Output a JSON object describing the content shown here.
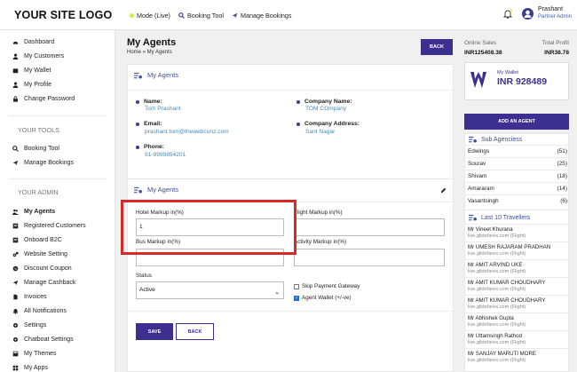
{
  "header": {
    "logo": "YOUR SITE LOGO",
    "nav": [
      {
        "label": "Mode (Live)",
        "icon": "status-dot-icon"
      },
      {
        "label": "Booking Tool",
        "icon": "search-icon"
      },
      {
        "label": "Manage Bookings",
        "icon": "plane-icon"
      }
    ],
    "user": {
      "name": "Prashant",
      "role": "Partner Admin"
    }
  },
  "sidebar": {
    "group1": [
      {
        "label": "Dashboard",
        "icon": "dashboard-icon"
      },
      {
        "label": "My Customers",
        "icon": "user-icon"
      },
      {
        "label": "My Wallet",
        "icon": "wallet-icon"
      },
      {
        "label": "My Profile",
        "icon": "user-icon"
      },
      {
        "label": "Change Password",
        "icon": "lock-icon"
      }
    ],
    "tools_heading": "YOUR TOOLS",
    "tools": [
      {
        "label": "Booking Tool",
        "icon": "search-icon"
      },
      {
        "label": "Manage Bookings",
        "icon": "plane-icon"
      }
    ],
    "admin_heading": "YOUR ADMIN",
    "admin": [
      {
        "label": "My Agents",
        "icon": "users-icon",
        "active": true
      },
      {
        "label": "Registered Customers",
        "icon": "list-icon"
      },
      {
        "label": "Onboard B2C",
        "icon": "list-icon"
      },
      {
        "label": "Website Setting",
        "icon": "gears-icon"
      },
      {
        "label": "Discount Coupon",
        "icon": "coupon-icon"
      },
      {
        "label": "Manage Cashback",
        "icon": "plane-icon"
      },
      {
        "label": "Invoices",
        "icon": "file-icon"
      },
      {
        "label": "All Notifications",
        "icon": "bell-icon"
      },
      {
        "label": "Settings",
        "icon": "gear-icon"
      },
      {
        "label": "Chatboat Settings",
        "icon": "gear-icon"
      },
      {
        "label": "My Themes",
        "icon": "theme-icon"
      },
      {
        "label": "My Apps",
        "icon": "apps-icon"
      }
    ]
  },
  "page": {
    "title": "My Agents",
    "breadcrumb": "Home » My Agents",
    "back_label": "BACK"
  },
  "agent_card": {
    "heading": "My Agents",
    "name_label": "Name:",
    "name": "Tom Prashant",
    "company_label": "Company Name:",
    "company": "TOM COmpany",
    "email_label": "Email:",
    "email": "prashant.tom@thewebconz.com",
    "address_label": "Company Address:",
    "address": "Sant Nagar",
    "phone_label": "Phone:",
    "phone": "91-9999854201"
  },
  "form": {
    "heading": "My Agents",
    "hotel_markup_label": "Hotel Markup in(%)",
    "hotel_markup_value": "1",
    "flight_markup_label": "Flight Markup in(%)",
    "flight_markup_value": "",
    "bus_markup_label": "Bus Markup in(%)",
    "bus_markup_value": "",
    "activity_markup_label": "Activity Markup in(%)",
    "activity_markup_value": "",
    "status_label": "Status",
    "status_value": "Active",
    "skip_payment_label": "Skip Payment Gateway",
    "skip_payment_checked": false,
    "agent_wallet_label": "Agent Wallet (+/-ve)",
    "agent_wallet_checked": true,
    "save_label": "SAVE",
    "back_label": "BACK"
  },
  "right_panel": {
    "online_sales_label": "Online Sales",
    "online_sales": "INR125408.38",
    "total_profit_label": "Total Profit",
    "total_profit": "INR38.78",
    "wallet_label": "My Wallet",
    "wallet_amount": "INR 928489",
    "add_agent_label": "ADD AN AGENT",
    "sub_agencies_heading": "Sub Agenciess",
    "sub_agencies": [
      {
        "name": "Edwings",
        "count": "(51)"
      },
      {
        "name": "Sourav",
        "count": "(25)"
      },
      {
        "name": "Shivam",
        "count": "(18)"
      },
      {
        "name": "Amararam",
        "count": "(14)"
      },
      {
        "name": "Vasantsingh",
        "count": "(6)"
      }
    ],
    "travellers_heading": "Last 10 Travellers",
    "travellers": [
      {
        "name": "Mr Vineet Khurana",
        "source": "live.glidefares.com (Flight)"
      },
      {
        "name": "Mr UMESH RAJARAM PRADHAN",
        "source": "live.glidefares.com (Flight)"
      },
      {
        "name": "Mr AMIT ARVIND UKE",
        "source": "live.glidefares.com (Flight)"
      },
      {
        "name": "Mr AMIT KUMAR CHOUDHARY",
        "source": "live.glidefares.com (Flight)"
      },
      {
        "name": "Mr AMIT KUMAR CHOUDHARY",
        "source": "live.glidefares.com (Flight)"
      },
      {
        "name": "Mr Abhishek Gupta",
        "source": "live.glidefares.com (Flight)"
      },
      {
        "name": "Mr Uttamsingh Rathod",
        "source": "live.glidefares.com (Flight)"
      },
      {
        "name": "Mr SANJAY MARUTI MORE",
        "source": "live.glidefares.com (Flight)"
      }
    ]
  },
  "colors": {
    "brand": "#3b2f8f",
    "highlight": "#d42a2a",
    "link": "#4a8ab0"
  }
}
